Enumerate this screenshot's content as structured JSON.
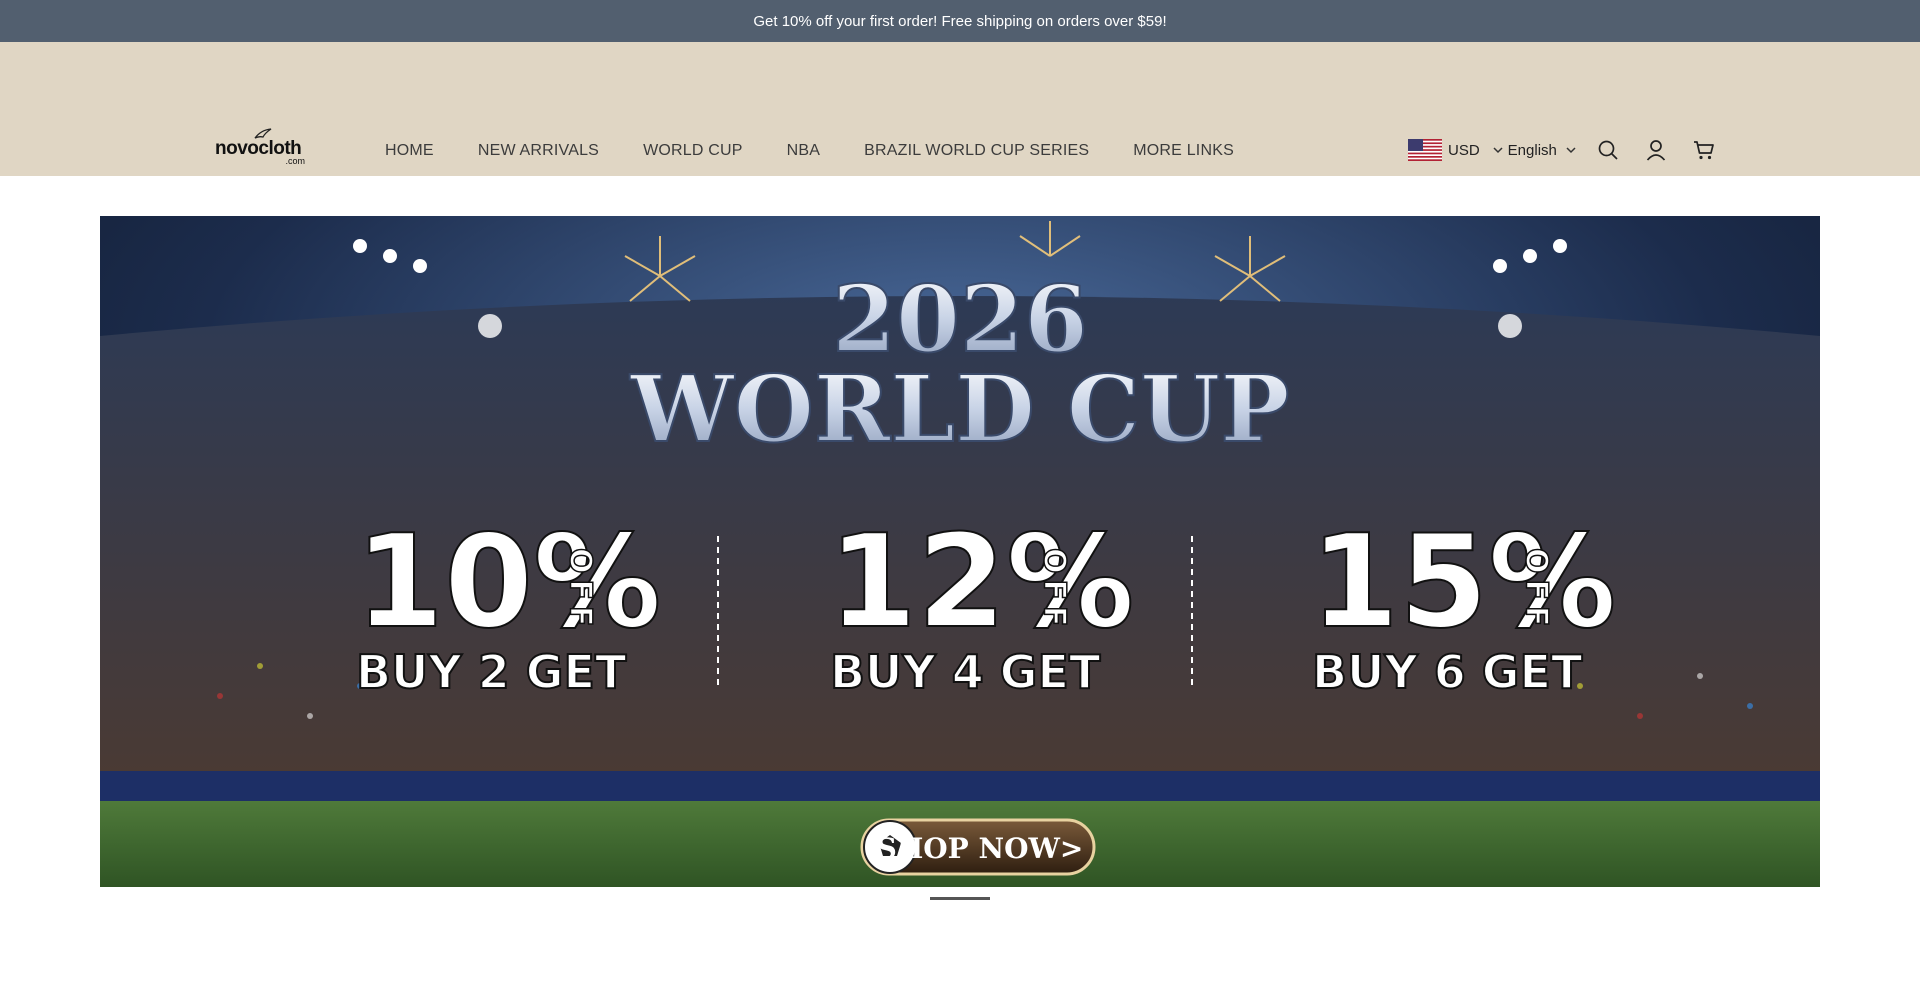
{
  "announcement": "Get 10% off your first order! Free shipping on orders over $59!",
  "brand": {
    "name": "novocloth",
    "suffix": ".com"
  },
  "nav": [
    "HOME",
    "NEW ARRIVALS",
    "WORLD CUP",
    "NBA",
    "BRAZIL WORLD CUP SERIES",
    "MORE LINKS"
  ],
  "currency": {
    "code": "USD",
    "icon": "us-flag-icon"
  },
  "language": "English",
  "icons": [
    "search-icon",
    "account-icon",
    "cart-icon"
  ],
  "hero": {
    "title_line1": "2026",
    "title_line2": "WORLD CUP",
    "offers": [
      {
        "pct": "10%",
        "off": "OFF",
        "label": "BUY 2 GET"
      },
      {
        "pct": "12%",
        "off": "OFF",
        "label": "BUY 4 GET"
      },
      {
        "pct": "15%",
        "off": "OFF",
        "label": "BUY 6 GET"
      }
    ],
    "cta": "SHOP NOW>"
  },
  "colors": {
    "announce_bg": "#525f6f",
    "header_bg": "#e0d6c4",
    "nav_text": "#3c3c3c"
  }
}
